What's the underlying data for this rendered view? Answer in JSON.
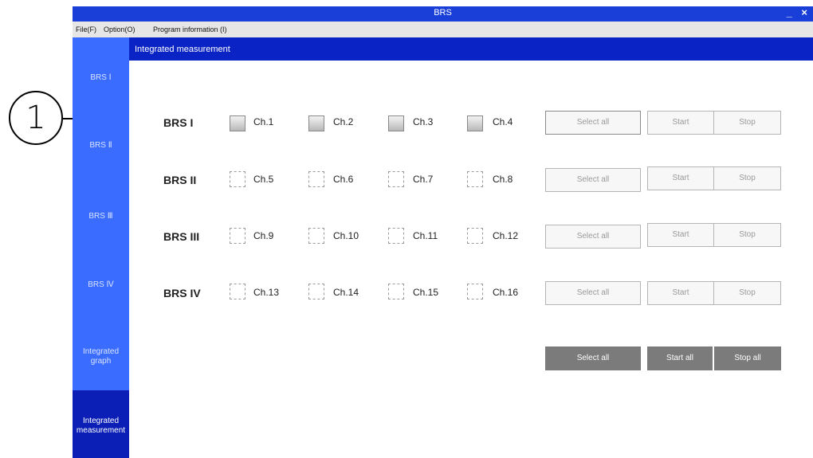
{
  "callout": {
    "number": "1"
  },
  "window": {
    "title": "BRS",
    "controls": "_ ×"
  },
  "menu": {
    "file": "File(F)",
    "option": "Option(O)",
    "program": "Program information (I)"
  },
  "sidebar": {
    "items": [
      {
        "label": "BRS Ⅰ"
      },
      {
        "label": "BRS Ⅱ"
      },
      {
        "label": "BRS Ⅲ"
      },
      {
        "label": "BRS Ⅳ"
      },
      {
        "label": "Integrated graph"
      },
      {
        "label": "Integrated measurement"
      }
    ]
  },
  "header": {
    "title": "Integrated measurement"
  },
  "rows": [
    {
      "label": "BRS I",
      "channels": [
        "Ch.1",
        "Ch.2",
        "Ch.3",
        "Ch.4"
      ],
      "select": "Select all",
      "start": "Start",
      "stop": "Stop"
    },
    {
      "label": "BRS II",
      "channels": [
        "Ch.5",
        "Ch.6",
        "Ch.7",
        "Ch.8"
      ],
      "select": "Select all",
      "start": "Start",
      "stop": "Stop"
    },
    {
      "label": "BRS III",
      "channels": [
        "Ch.9",
        "Ch.10",
        "Ch.11",
        "Ch.12"
      ],
      "select": "Select all",
      "start": "Start",
      "stop": "Stop"
    },
    {
      "label": "BRS IV",
      "channels": [
        "Ch.13",
        "Ch.14",
        "Ch.15",
        "Ch.16"
      ],
      "select": "Select all",
      "start": "Start",
      "stop": "Stop"
    }
  ],
  "global": {
    "select": "Select all",
    "start": "Start all",
    "stop": "Stop all"
  },
  "colors": {
    "titlebar": "#1a3fd8",
    "sidebar": "#3a6dff",
    "sidebar_active": "#0b1fb6",
    "header": "#0a23c4",
    "dark_button": "#7b7b7b"
  }
}
